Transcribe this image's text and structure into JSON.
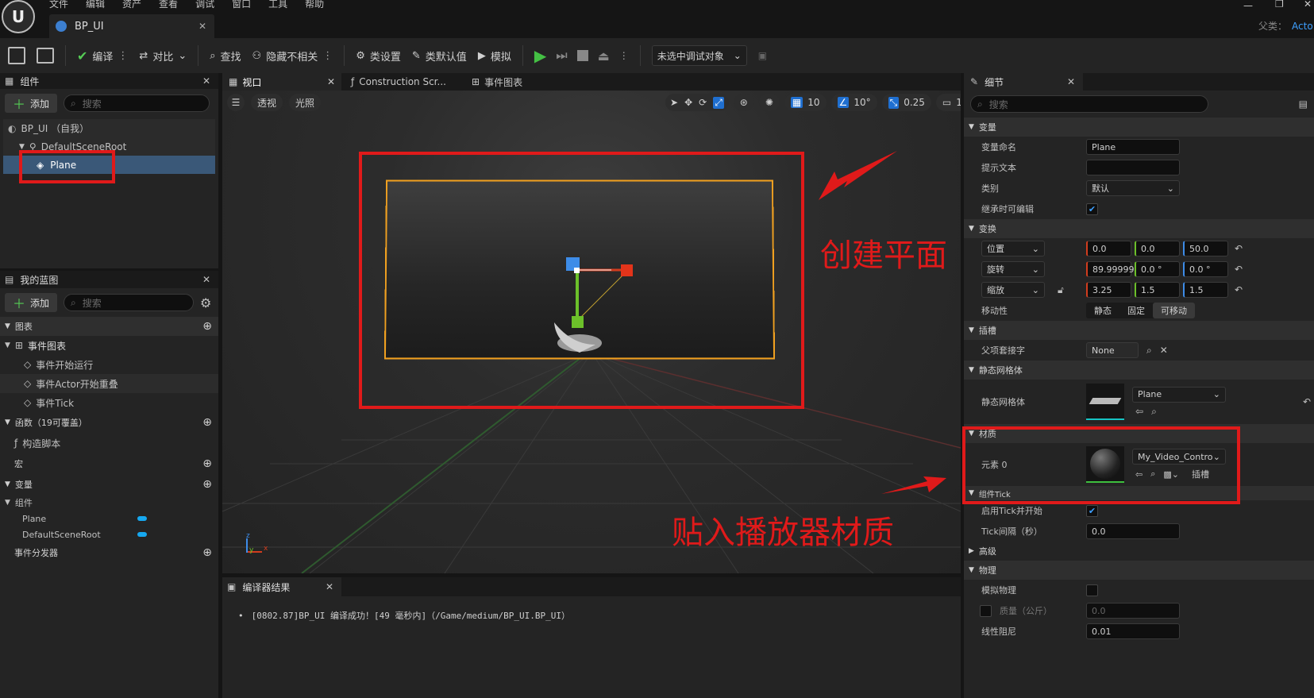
{
  "menu": [
    "文件",
    "编辑",
    "资产",
    "查看",
    "调试",
    "窗口",
    "工具",
    "帮助"
  ],
  "doc_tab": "BP_UI",
  "parent_label": "父类：",
  "parent_value": "Acto",
  "toolbar": {
    "compile": "编译",
    "diff": "对比",
    "find": "查找",
    "hide_unrelated": "隐藏不相关",
    "class_settings": "类设置",
    "class_defaults": "类默认值",
    "simulate": "模拟",
    "debug_target": "未选中调试对象"
  },
  "components_panel": {
    "title": "组件",
    "add": "添加",
    "search_placeholder": "搜索",
    "tree": [
      "BP_UI （自我）",
      "DefaultSceneRoot",
      "Plane"
    ]
  },
  "blueprint_panel": {
    "title": "我的蓝图",
    "add": "添加",
    "search_placeholder": "搜索",
    "graphs": "图表",
    "event_graph": "事件图表",
    "events": [
      "事件开始运行",
      "事件Actor开始重叠",
      "事件Tick"
    ],
    "functions": "函数（19可覆盖）",
    "construction_script": "构造脚本",
    "macros": "宏",
    "variables": "变量",
    "components_group": "组件",
    "component_vars": [
      "Plane",
      "DefaultSceneRoot"
    ],
    "event_dispatchers": "事件分发器"
  },
  "center_tabs": [
    "视口",
    "Construction Scr...",
    "事件图表"
  ],
  "viewport": {
    "perspective": "透视",
    "lit": "光照",
    "grid_snap": "10",
    "rot_snap": "10°",
    "scale_snap": "0.25",
    "cam_speed": "1"
  },
  "compiler": {
    "title": "编译器结果",
    "message": "[0802.87]BP_UI 编译成功！[49 毫秒内]（/Game/medium/BP_UI.BP_UI）"
  },
  "details": {
    "title": "细节",
    "search_placeholder": "搜索",
    "sections": {
      "variable": "变量",
      "transform": "变换",
      "sockets": "插槽",
      "static_mesh": "静态网格体",
      "materials": "材质",
      "component_tick": "组件Tick",
      "advanced": "高级",
      "physics": "物理"
    },
    "var_name_label": "变量命名",
    "var_name_value": "Plane",
    "tooltip_label": "提示文本",
    "category_label": "类别",
    "category_value": "默认",
    "editable_label": "继承时可编辑",
    "location_label": "位置",
    "location": [
      "0.0",
      "0.0",
      "50.0"
    ],
    "rotation_label": "旋转",
    "rotation": [
      "89.99999",
      "0.0 °",
      "0.0 °"
    ],
    "scale_label": "缩放",
    "scale": [
      "3.25",
      "1.5",
      "1.5"
    ],
    "mobility_label": "移动性",
    "mobility": [
      "静态",
      "固定",
      "可移动"
    ],
    "parent_socket_label": "父项套接字",
    "parent_socket_value": "None",
    "static_mesh_label": "静态网格体",
    "static_mesh_value": "Plane",
    "element0_label": "元素 0",
    "material_value": "My_Video_Controll",
    "slot_label": "插槽",
    "start_tick_label": "启用Tick并开始",
    "tick_interval_label": "Tick间隔（秒）",
    "tick_interval_value": "0.0",
    "simulate_physics_label": "模拟物理",
    "mass_label": "质量（公斤）",
    "mass_value": "0.0",
    "linear_damping_label": "线性阻尼",
    "linear_damping_value": "0.01"
  },
  "annotations": {
    "create_plane": "创建平面",
    "apply_material": "贴入播放器材质"
  },
  "colors": {
    "accent_red": "#e01a1a",
    "select_blue": "#3a5878",
    "play_green": "#44c044",
    "outline_orange": "#f0a020"
  }
}
